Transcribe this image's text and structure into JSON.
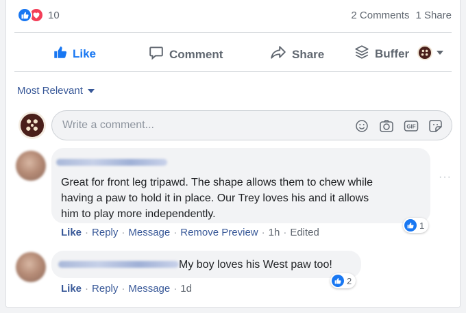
{
  "reactions": {
    "count": "10",
    "types": [
      "like",
      "love"
    ],
    "colors": {
      "like": "#1877f2",
      "love": "#f33e58"
    }
  },
  "engagement": {
    "comments": "2 Comments",
    "shares": "1 Share"
  },
  "actions": {
    "like": "Like",
    "comment": "Comment",
    "share": "Share",
    "buffer": "Buffer"
  },
  "sort": {
    "label": "Most Relevant"
  },
  "composer": {
    "placeholder": "Write a comment...",
    "icons": [
      "emoji-icon",
      "camera-icon",
      "gif-icon",
      "sticker-icon"
    ]
  },
  "comments": [
    {
      "text_lines": [
        "Great for front leg tripawd. The shape allows them to chew while",
        "having a paw to hold it in place. Our Trey loves his and it allows",
        "him to play more independently."
      ],
      "reaction_count": "1",
      "actions": [
        "Like",
        "Reply",
        "Message",
        "Remove Preview",
        "1h",
        "Edited"
      ]
    },
    {
      "text": "My boy loves his West paw too!",
      "reaction_count": "2",
      "actions": [
        "Like",
        "Reply",
        "Message",
        "1d"
      ]
    }
  ],
  "more_options": "···",
  "accent": {
    "brand_blue": "#1877f2",
    "link_blue": "#385898",
    "muted_gray": "#606770"
  }
}
